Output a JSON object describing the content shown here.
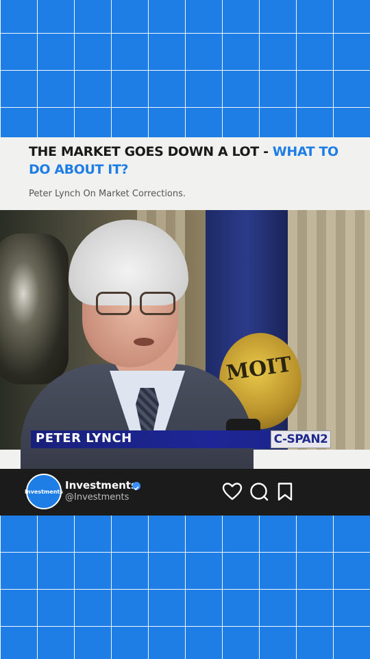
{
  "post": {
    "headline_main": "THE MARKET GOES DOWN A LOT - ",
    "headline_accent": "WHAT TO DO ABOUT IT?",
    "subtitle": "Peter Lynch On Market Corrections."
  },
  "video": {
    "lower_third_name": "PETER LYNCH",
    "channel_bug": "C-SPAN2",
    "seal_text": "MOIT"
  },
  "profile": {
    "avatar_text": "Investments",
    "account_name": "Investments",
    "handle": "@Investments",
    "verified": true
  },
  "actions": [
    {
      "icon": "heart-icon",
      "label": "like"
    },
    {
      "icon": "comment-icon",
      "label": "comment"
    },
    {
      "icon": "bookmark-icon",
      "label": "save"
    }
  ],
  "colors": {
    "accent": "#1f7de6",
    "grid_bg": "#1f7de6",
    "card_bg": "#f1f1f0",
    "bar_bg": "#1b1b1b"
  }
}
